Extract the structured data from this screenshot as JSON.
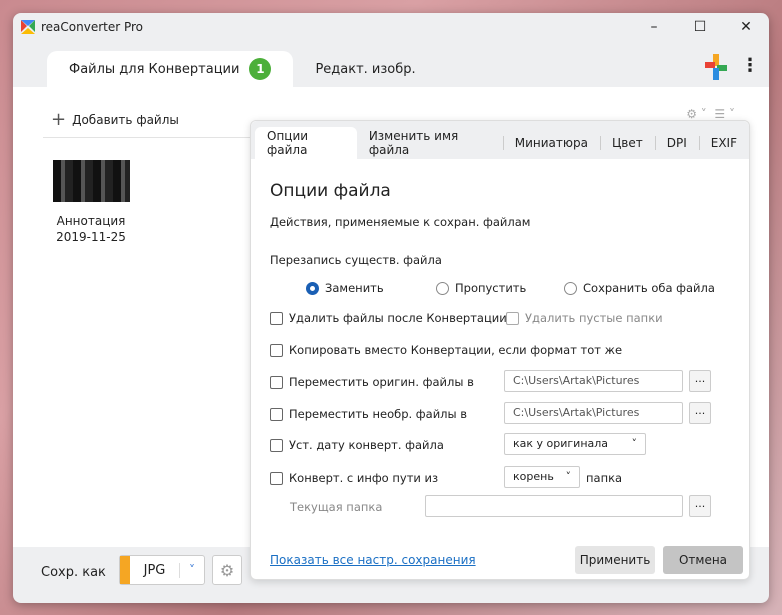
{
  "window": {
    "title": "reaConverter Pro",
    "minimize": "–",
    "maximize": "☐",
    "close": "✕"
  },
  "tabs": [
    {
      "label": "Файлы для Конвертации",
      "badge": "1"
    },
    {
      "label": "Редакт. изобр."
    }
  ],
  "menu_icon": "⋮",
  "files": {
    "add_label": "Добавить файлы",
    "items": [
      {
        "name": "Аннотация",
        "date": "2019-11-25"
      }
    ]
  },
  "bottom": {
    "save_as_label": "Сохр. как",
    "format": "JPG"
  },
  "dialog": {
    "tabs": [
      "Опции файла",
      "Изменить имя файла",
      "Миниатюра",
      "Цвет",
      "DPI",
      "EXIF"
    ],
    "title": "Опции файла",
    "subtitle": "Действия, применяемые к сохран. файлам",
    "overwrite_label": "Перезапись существ. файла",
    "overwrite_options": [
      {
        "label": "Заменить",
        "selected": true
      },
      {
        "label": "Пропустить",
        "selected": false
      },
      {
        "label": "Сохранить оба файла",
        "selected": false
      }
    ],
    "delete_after": {
      "label": "Удалить файлы после Конвертации",
      "checked": false
    },
    "delete_empty": {
      "label": "Удалить пустые папки",
      "checked": false,
      "disabled": true
    },
    "copy_instead": {
      "label": "Копировать вместо Конвертации, если формат тот же",
      "checked": false
    },
    "move_orig": {
      "label": "Переместить оригин. файлы в",
      "checked": false,
      "path": "C:\\Users\\Artak\\Pictures"
    },
    "move_unproc": {
      "label": "Переместить необр. файлы в",
      "checked": false,
      "path": "C:\\Users\\Artak\\Pictures"
    },
    "set_date": {
      "label": "Уст. дату конверт. файла",
      "checked": false,
      "value": "как у оригинала"
    },
    "path_info": {
      "label": "Конверт. с инфо пути из",
      "checked": false,
      "value": "корень",
      "suffix": "папка"
    },
    "current_folder": {
      "label": "Текущая папка",
      "value": ""
    },
    "browse": "...",
    "show_all_link": "Показать все настр. сохранения",
    "apply": "Применить",
    "cancel": "Отмена"
  }
}
